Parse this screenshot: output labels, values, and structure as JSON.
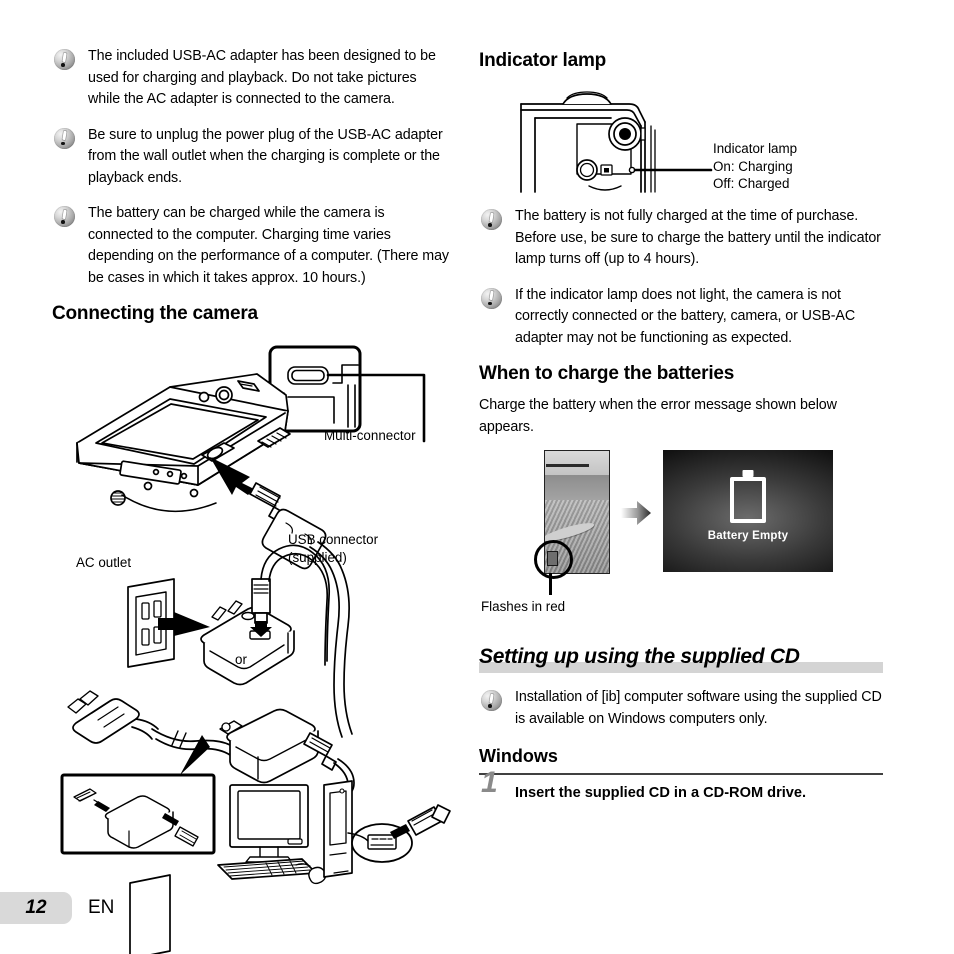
{
  "left_column": {
    "notes": [
      "The included USB-AC adapter has been designed to be used for charging and playback. Do not take pictures while the AC adapter is connected to the camera.",
      "Be sure to unplug the power plug of the USB-AC adapter from the wall outlet when the charging is complete or the playback ends.",
      "The battery can be charged while the camera is connected to the computer. Charging time varies depending on the performance of a computer. (There may be cases in which it takes approx. 10 hours.)"
    ],
    "connecting_heading": "Connecting the camera",
    "figure_labels": {
      "multi_connector": "Multi-connector",
      "ac_outlet": "AC outlet",
      "usb_connector": "USB connector\n(supplied)",
      "or": "or"
    }
  },
  "right_column": {
    "indicator_heading": "Indicator lamp",
    "indicator_labels": {
      "line1": "Indicator lamp",
      "line2": "On: Charging",
      "line3": "Off: Charged"
    },
    "notes": [
      "The battery is not fully charged at the time of purchase. Before use, be sure to charge the battery until the indicator lamp turns off (up to 4 hours).",
      "If the indicator lamp does not light, the camera is not correctly connected or the battery, camera, or USB-AC adapter may not be functioning as expected."
    ],
    "when_to_charge_heading": "When to charge the batteries",
    "when_to_charge_body": "Charge the battery when the error message shown below appears.",
    "battery_figure": {
      "flashes_label": "Flashes in red",
      "lcd_message": "Battery Empty"
    },
    "cd_section_heading": "Setting up using the supplied CD",
    "cd_note": "Installation of [ib] computer software using the supplied CD is available on Windows computers only.",
    "windows_heading": "Windows",
    "step_number": "1",
    "step_text": "Insert the supplied CD in a CD-ROM drive."
  },
  "footer": {
    "page_number": "12",
    "language": "EN"
  },
  "colors": {
    "band_gray": "#d4d4d4",
    "tab_gray": "#d9d9d9",
    "step_num_gray": "#8a8a8a",
    "ink": "#000000"
  }
}
